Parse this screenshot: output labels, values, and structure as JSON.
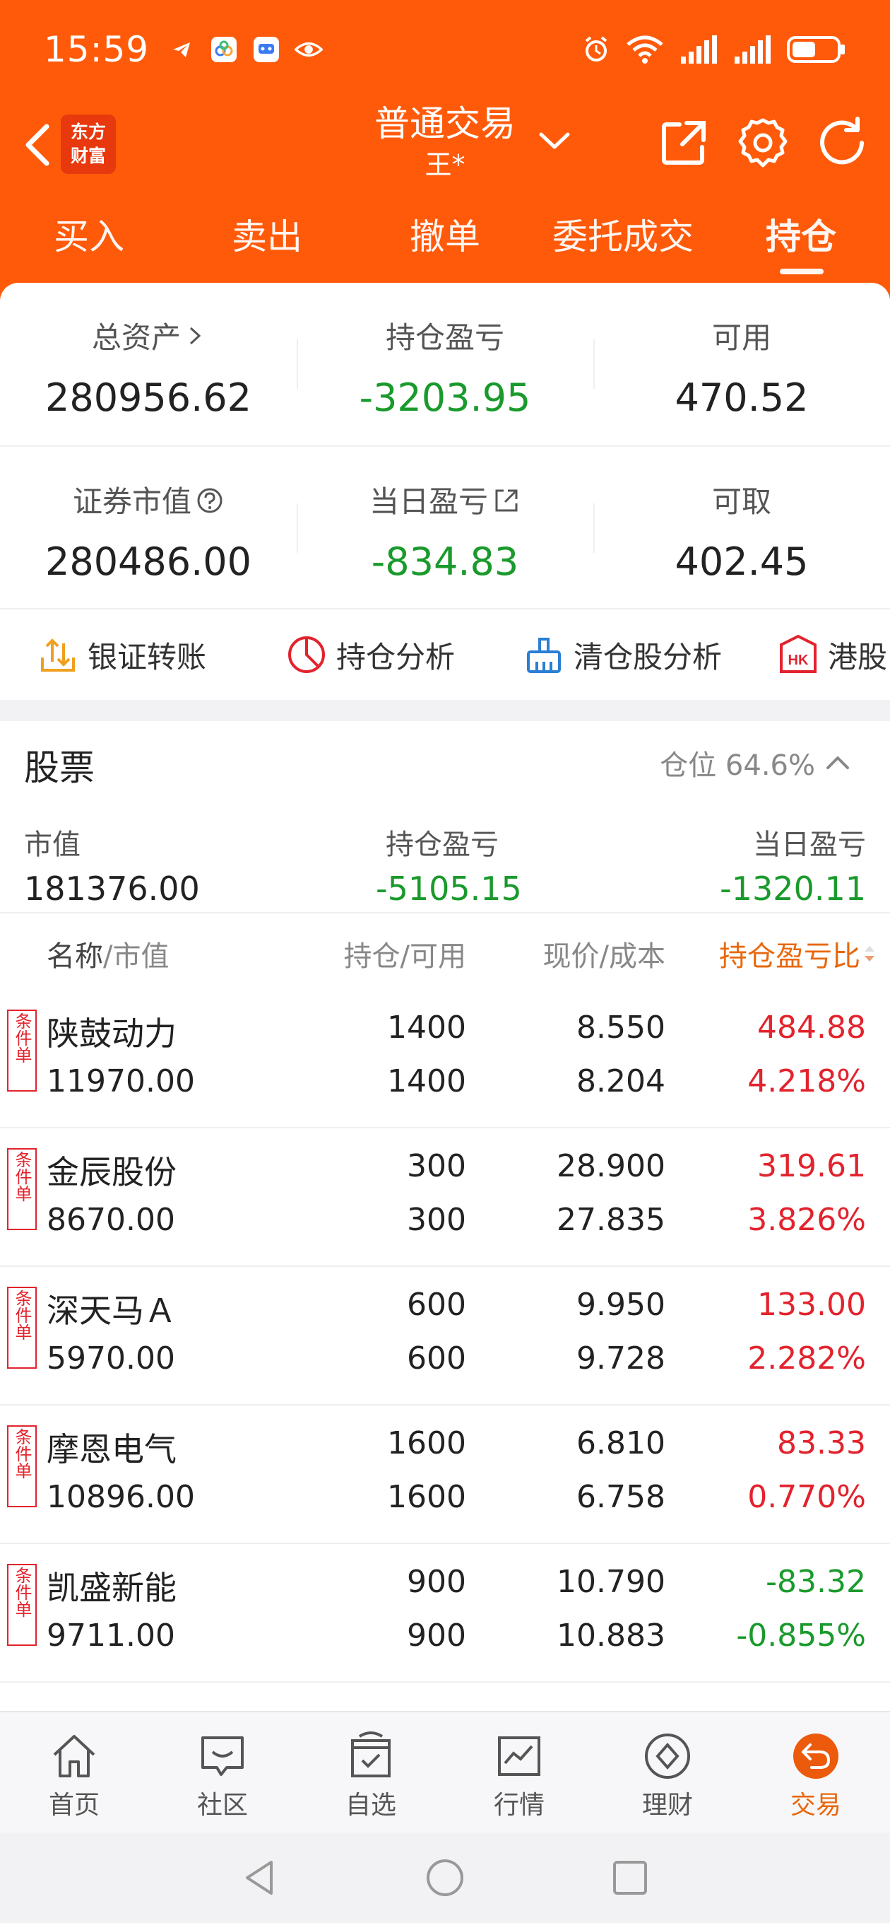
{
  "status_bar": {
    "time": "15:59",
    "left_icons": [
      "telegram-icon",
      "cloud-icon",
      "robot-icon",
      "eye-icon"
    ],
    "right_icons": [
      "alarm-icon",
      "wifi-icon",
      "signal-icon",
      "signal-icon",
      "battery-icon"
    ]
  },
  "header": {
    "logo_line1": "东方",
    "logo_line2": "财富",
    "title": "普通交易",
    "account": "王*"
  },
  "tabs": [
    {
      "label": "买入"
    },
    {
      "label": "卖出"
    },
    {
      "label": "撤单"
    },
    {
      "label": "委托成交"
    },
    {
      "label": "持仓"
    }
  ],
  "summary": {
    "total_assets_label": "总资产",
    "total_assets": "280956.62",
    "position_pl_label": "持仓盈亏",
    "position_pl": "-3203.95",
    "available_label": "可用",
    "available": "470.52",
    "market_value_label": "证券市值",
    "market_value": "280486.00",
    "daily_pl_label": "当日盈亏",
    "daily_pl": "-834.83",
    "withdrawable_label": "可取",
    "withdrawable": "402.45"
  },
  "quick_actions": [
    {
      "label": "银证转账",
      "icon": "transfer-icon"
    },
    {
      "label": "持仓分析",
      "icon": "pie-chart-icon"
    },
    {
      "label": "清仓股分析",
      "icon": "broom-icon"
    },
    {
      "label": "港股",
      "icon": "hk-icon"
    }
  ],
  "stocks": {
    "title": "股票",
    "position_ratio": "仓位 64.6%",
    "market_value_label": "市值",
    "market_value": "181376.00",
    "position_pl_label": "持仓盈亏",
    "position_pl": "-5105.15",
    "daily_pl_label": "当日盈亏",
    "daily_pl": "-1320.11",
    "columns": {
      "name": "名称",
      "name_sub": "/市值",
      "holding": "持仓/可用",
      "price": "现价/成本",
      "pl_ratio": "持仓盈亏比"
    },
    "tag": "条件单",
    "rows": [
      {
        "name": "陕鼓动力",
        "mv": "11970.00",
        "hold": "1400",
        "avail": "1400",
        "price": "8.550",
        "cost": "8.204",
        "pl": "484.88",
        "ratio": "4.218%"
      },
      {
        "name": "金辰股份",
        "mv": "8670.00",
        "hold": "300",
        "avail": "300",
        "price": "28.900",
        "cost": "27.835",
        "pl": "319.61",
        "ratio": "3.826%"
      },
      {
        "name": "深天马Ａ",
        "mv": "5970.00",
        "hold": "600",
        "avail": "600",
        "price": "9.950",
        "cost": "9.728",
        "pl": "133.00",
        "ratio": "2.282%"
      },
      {
        "name": "摩恩电气",
        "mv": "10896.00",
        "hold": "1600",
        "avail": "1600",
        "price": "6.810",
        "cost": "6.758",
        "pl": "83.33",
        "ratio": "0.770%"
      },
      {
        "name": "凯盛新能",
        "mv": "9711.00",
        "hold": "900",
        "avail": "900",
        "price": "10.790",
        "cost": "10.883",
        "pl": "-83.32",
        "ratio": "-0.855%"
      }
    ]
  },
  "bottom_nav": [
    {
      "label": "首页",
      "icon": "home-icon"
    },
    {
      "label": "社区",
      "icon": "chat-icon"
    },
    {
      "label": "自选",
      "icon": "check-box-icon"
    },
    {
      "label": "行情",
      "icon": "chart-icon"
    },
    {
      "label": "理财",
      "icon": "diamond-icon"
    },
    {
      "label": "交易",
      "icon": "trade-icon"
    }
  ],
  "colors": {
    "brand_orange": "#ff5a0a",
    "gain_red": "#e2232d",
    "loss_green": "#1a9a2c"
  }
}
